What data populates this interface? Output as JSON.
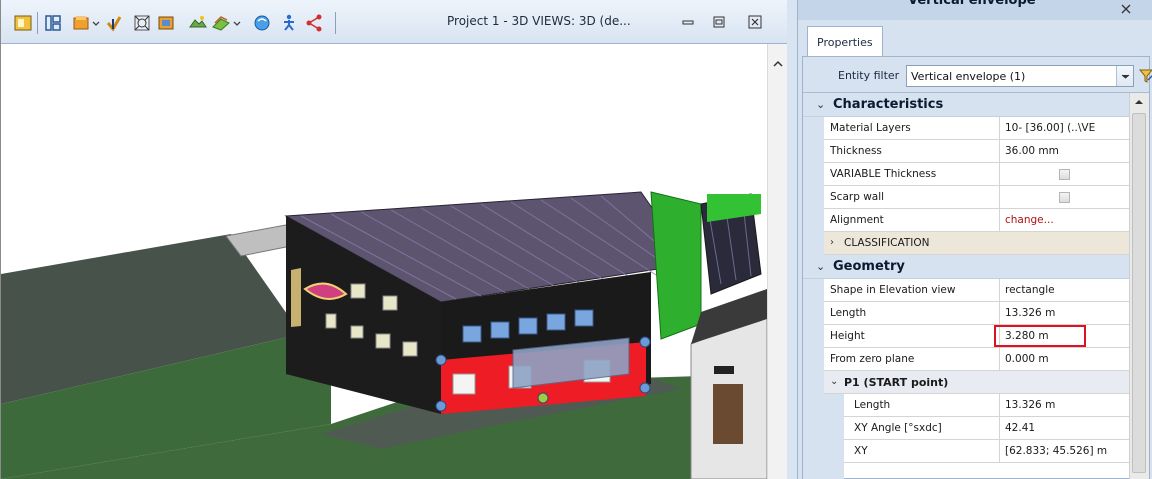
{
  "view": {
    "title": "Project 1 - 3D VIEWS: 3D (de..."
  },
  "panel": {
    "header_title": "Vertical envelope",
    "tab_label": "Properties",
    "entity_filter_label": "Entity filter",
    "entity_filter_value": "Vertical envelope (1)"
  },
  "sections": {
    "characteristics": {
      "title": "Characteristics",
      "rows": [
        {
          "name": "Material Layers",
          "value": "10- [36.00]  (..\\VE"
        },
        {
          "name": "Thickness",
          "value": "36.00 mm"
        },
        {
          "name": "VARIABLE Thickness",
          "value": ""
        },
        {
          "name": "Scarp wall",
          "value": ""
        },
        {
          "name": "Alignment",
          "value": "change..."
        }
      ],
      "subsection": "CLASSIFICATION"
    },
    "geometry": {
      "title": "Geometry",
      "rows": [
        {
          "name": "Shape in Elevation view",
          "value": "rectangle"
        },
        {
          "name": "Length",
          "value": "13.326 m"
        },
        {
          "name": "Height",
          "value": "3.280 m"
        },
        {
          "name": "From zero plane",
          "value": "0.000 m"
        }
      ],
      "subsection": "P1 (START point)",
      "sub_rows": [
        {
          "name": "Length",
          "value": "13.326 m"
        },
        {
          "name": "XY Angle  [°sxdc]",
          "value": "42.41"
        },
        {
          "name": "XY",
          "value": "[62.833; 45.526] m"
        }
      ]
    }
  },
  "colors": {
    "alignment_link": "#b01010",
    "highlight": "#e01020",
    "selected_wall": "#ee1c24"
  }
}
